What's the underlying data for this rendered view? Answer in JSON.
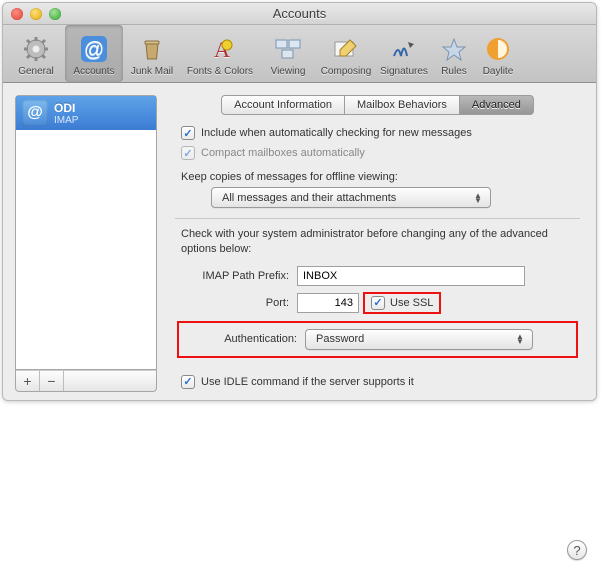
{
  "window_title": "Accounts",
  "toolbar": {
    "items": [
      {
        "label": "General"
      },
      {
        "label": "Accounts"
      },
      {
        "label": "Junk Mail"
      },
      {
        "label": "Fonts & Colors"
      },
      {
        "label": "Viewing"
      },
      {
        "label": "Composing"
      },
      {
        "label": "Signatures"
      },
      {
        "label": "Rules"
      },
      {
        "label": "Daylite"
      }
    ]
  },
  "sidebar": {
    "account_name": "ODI",
    "account_type": "IMAP",
    "add_label": "+",
    "remove_label": "−"
  },
  "tabs": {
    "info": "Account Information",
    "mailbox": "Mailbox Behaviors",
    "advanced": "Advanced"
  },
  "advanced": {
    "include_check": "Include when automatically checking for new messages",
    "compact_check": "Compact mailboxes automatically",
    "keep_label": "Keep copies of messages for offline viewing:",
    "keep_select": "All messages and their attachments",
    "admin_hint": "Check with your system administrator before changing any of the advanced options below:",
    "imap_prefix_label": "IMAP Path Prefix:",
    "imap_prefix_value": "INBOX",
    "port_label": "Port:",
    "port_value": "143",
    "use_ssl_label": "Use SSL",
    "auth_label": "Authentication:",
    "auth_value": "Password",
    "idle_label": "Use IDLE command if the server supports it"
  },
  "help_label": "?"
}
